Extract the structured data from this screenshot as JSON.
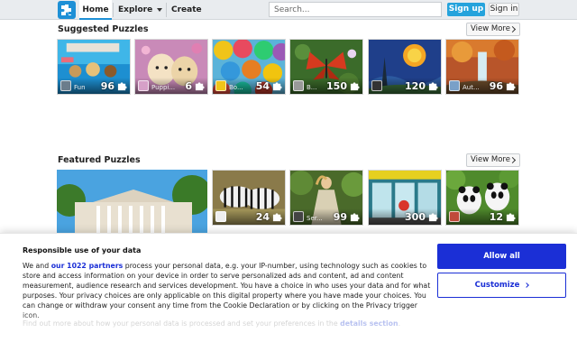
{
  "nav": {
    "home": "Home",
    "explore": "Explore",
    "create": "Create",
    "search_placeholder": "Search...",
    "signup": "Sign up",
    "signin": "Sign in"
  },
  "suggested": {
    "title": "Suggested Puzzles",
    "view_more": "View More",
    "items": [
      {
        "author": "Fun",
        "count": "96",
        "theme": "pool-dogs"
      },
      {
        "author": "Puppi...",
        "count": "6",
        "theme": "puppies"
      },
      {
        "author": "Bo...",
        "count": "54",
        "theme": "umbrellas"
      },
      {
        "author": "B...",
        "count": "150",
        "theme": "butterfly"
      },
      {
        "author": "",
        "count": "120",
        "theme": "starry-night"
      },
      {
        "author": "Aut...",
        "count": "96",
        "theme": "waterfall"
      }
    ]
  },
  "featured": {
    "title": "Featured Puzzles",
    "view_more": "View More",
    "items": [
      {
        "author": "",
        "count": "",
        "theme": "building"
      },
      {
        "author": "",
        "count": "24",
        "theme": "zebras"
      },
      {
        "author": "Ser...",
        "count": "99",
        "theme": "woman-dress"
      },
      {
        "author": "",
        "count": "300",
        "theme": "shop"
      },
      {
        "author": "",
        "count": "12",
        "theme": "pandas"
      }
    ]
  },
  "cookie": {
    "title": "Responsible use of your data",
    "text_before": "We and ",
    "partners": "our 1022 partners",
    "text_after": " process your personal data, e.g. your IP-number, using technology such as cookies to store and access information on your device in order to serve personalized ads and content, ad and content measurement, audience research and services development. You have a choice in who uses your data and for what purposes. Your privacy choices are only applicable on this digital property where you have made your choices. You can change or withdraw your consent any time from the Cookie Declaration or by clicking on the Privacy trigger icon.",
    "more_before": "Find out more about how your personal data is processed and set your preferences in the ",
    "more_link": "details section",
    "more_after": ".",
    "allow": "Allow all",
    "customize": "Customize"
  },
  "colors": {
    "brand_blue": "#25a3dc",
    "consent_blue": "#1b2fd6"
  }
}
